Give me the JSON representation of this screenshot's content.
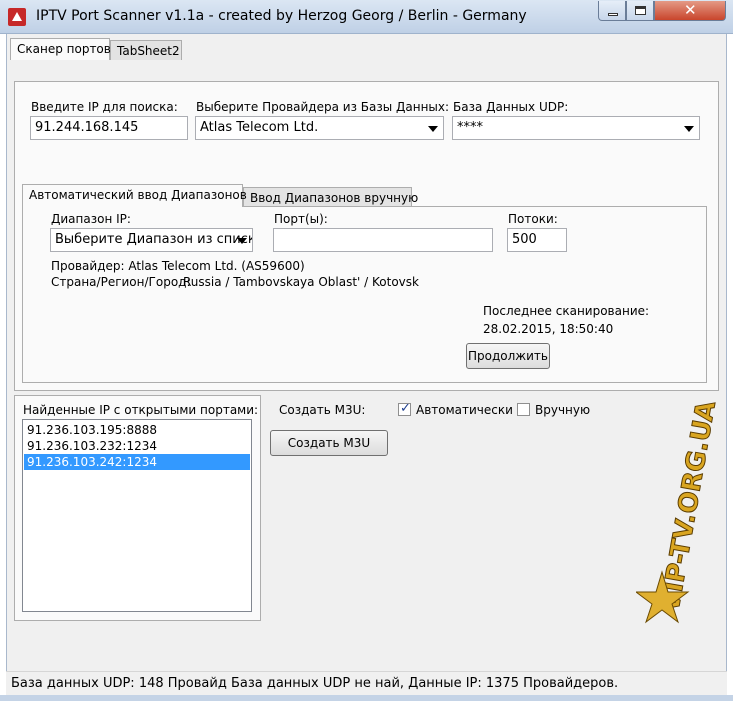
{
  "window": {
    "title": "IPTV Port Scanner v1.1a - created by Herzog Georg / Berlin - Germany"
  },
  "tabs": [
    "Сканер портов",
    "TabSheet2"
  ],
  "search": {
    "ip_label": "Введите IP для поиска:",
    "ip_value": "91.244.168.145",
    "provider_label": "Выберите Провайдера из Базы Данных:",
    "provider_value": "Atlas Telecom Ltd.",
    "udp_label": "База Данных UDP:",
    "udp_value": "****"
  },
  "range_tabs": [
    "Автоматический ввод Диапазонов",
    "Ввод Диапазонов вручную"
  ],
  "range": {
    "ip_range_label": "Диапазон IP:",
    "ip_range_value": "Выберите Диапазон из списк",
    "ports_label": "Порт(ы):",
    "ports_value": "",
    "threads_label": "Потоки:",
    "threads_value": "500",
    "provider_line": "Провайдер: Atlas Telecom Ltd. (AS59600)",
    "country_key": "Страна/Регион/Город:",
    "country_value": "Russia / Tambovskaya Oblast' / Kotovsk",
    "last_scan_label": "Последнее сканирование:",
    "last_scan_value": "28.02.2015, 18:50:40",
    "continue_label": "Продолжить"
  },
  "found": {
    "label": "Найденные IP с открытыми портами:",
    "items": [
      "91.236.103.195:8888",
      "91.236.103.232:1234",
      "91.236.103.242:1234"
    ],
    "selected_index": 2
  },
  "m3u": {
    "label": "Создать M3U:",
    "auto_label": "Автоматически",
    "auto_checked": true,
    "manual_label": "Вручную",
    "manual_checked": false,
    "create_label": "Создать M3U"
  },
  "watermark": {
    "text": "VIP-TV.ORG.UA"
  },
  "status": {
    "text": "База данных UDP: 148 Провайд База данных UDP не най, Данные IP: 1375 Провайдеров."
  },
  "colors": {
    "selection": "#3399ff",
    "watermark_gold": "#d9a520",
    "close_red": "#c9452c"
  }
}
